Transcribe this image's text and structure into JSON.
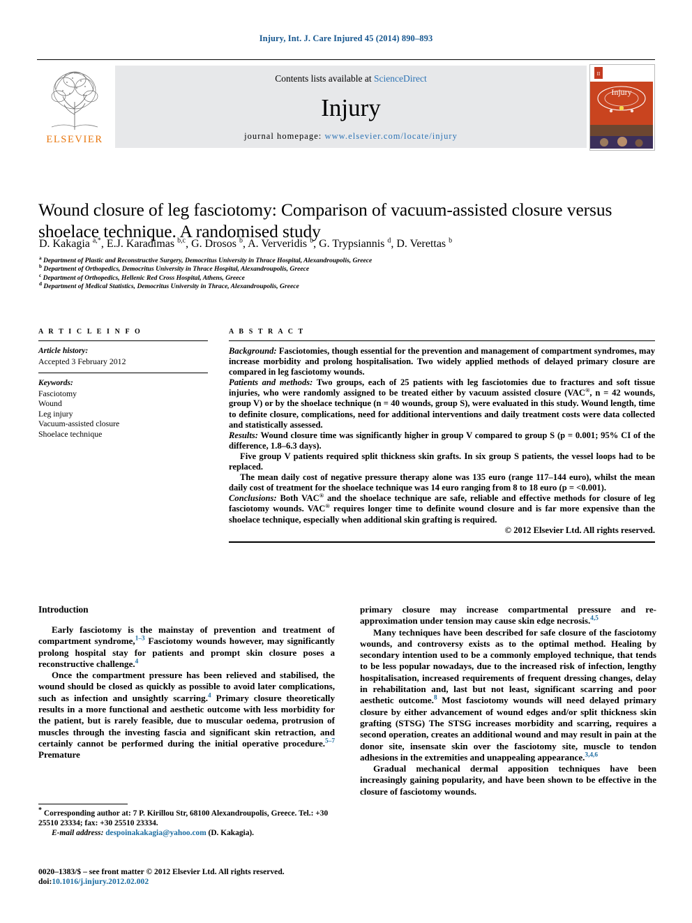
{
  "runhead": "Injury, Int. J. Care Injured 45 (2014) 890–893",
  "masthead": {
    "contents_prefix": "Contents lists available at ",
    "sciencedirect": "ScienceDirect",
    "journal_name": "Injury",
    "homepage_label": "journal homepage: ",
    "homepage_url": "www.elsevier.com/locate/injury",
    "publisher": "ELSEVIER",
    "accent_orange": "#e8760d",
    "link_blue": "#2e74b5",
    "panel_grey": "#e7e8ea"
  },
  "article": {
    "title": "Wound closure of leg fasciotomy: Comparison of vacuum-assisted closure versus shoelace technique. A randomised study",
    "authors_html": "D. Kakagia <sup>a,*</sup>, E.J. Karadimas <sup>b,c</sup>, G. Drosos <sup>b</sup>, A. Ververidis <sup>b</sup>, G. Trypsiannis <sup>d</sup>, D. Verettas <sup>b</sup>",
    "affiliations": [
      "Department of Plastic and Reconstructive Surgery, Democritus University in Thrace Hospital, Alexandroupolis, Greece",
      "Department of Orthopedics, Democritus University in Thrace Hospital, Alexandroupolis, Greece",
      "Department of Orthopedics, Hellenic Red Cross Hospital, Athens, Greece",
      "Department of Medical Statistics, Democritus University in Thrace, Alexandroupolis, Greece"
    ],
    "affiliation_marks": [
      "a",
      "b",
      "c",
      "d"
    ]
  },
  "article_info": {
    "heading": "A R T I C L E   I N F O",
    "history_label": "Article history:",
    "history_value": "Accepted 3 February 2012",
    "keywords_label": "Keywords:",
    "keywords": [
      "Fasciotomy",
      "Wound",
      "Leg injury",
      "Vacuum-assisted closure",
      "Shoelace technique"
    ]
  },
  "abstract": {
    "heading": "A B S T R A C T",
    "paragraphs": [
      {
        "label": "Background:",
        "text": " Fasciotomies, though essential for the prevention and management of compartment syndromes, may increase morbidity and prolong hospitalisation. Two widely applied methods of delayed primary closure are compared in leg fasciotomy wounds."
      },
      {
        "label": "Patients and methods:",
        "text": " Two groups, each of 25 patients with leg fasciotomies due to fractures and soft tissue injuries, who were randomly assigned to be treated either by vacuum assisted closure (VAC<sup>®</sup>, n = 42 wounds, group V) or by the shoelace technique (n = 40 wounds, group S), were evaluated in this study. Wound length, time to definite closure, complications, need for additional interventions and daily treatment costs were data collected and statistically assessed."
      },
      {
        "label": "Results:",
        "text": "  Wound closure time was significantly higher in group V compared to group S (p = 0.001; 95% CI of the difference, 1.8–6.3 days)."
      },
      {
        "label": "",
        "indent": true,
        "text": "Five group V patients required split thickness skin grafts. In six group S patients, the vessel loops had to be replaced."
      },
      {
        "label": "",
        "indent": true,
        "text": "The mean daily cost of negative pressure therapy alone was 135 euro (range 117–144 euro), whilst the mean daily cost of treatment for the shoelace technique was 14 euro ranging from 8 to 18 euro (p = <0.001)."
      },
      {
        "label": "Conclusions:",
        "text": "  Both VAC<sup>®</sup> and the shoelace technique are safe, reliable and effective methods for closure of leg fasciotomy wounds. VAC<sup>®</sup> requires longer time to definite wound closure and is far more expensive than the shoelace technique, especially when additional skin grafting is required."
      }
    ],
    "copyright": "© 2012 Elsevier Ltd. All rights reserved."
  },
  "body": {
    "intro_heading": "Introduction",
    "left_paragraphs": [
      "Early fasciotomy is the mainstay of prevention and treatment of compartment syndrome,<sup class=\"ref\">1–3</sup> Fasciotomy wounds however, may significantly prolong hospital stay for patients and prompt skin closure poses a reconstructive challenge.<sup class=\"ref\">4</sup>",
      "Once the compartment pressure has been relieved and stabilised, the wound should be closed as quickly as possible to avoid later complications, such as infection and unsightly scarring.<sup class=\"ref\">4</sup> Primary closure theoretically results in a more functional and aesthetic outcome with less morbidity for the patient, but is rarely feasible, due to muscular oedema, protrusion of muscles through the investing fascia and significant skin retraction, and certainly cannot be performed during the initial operative procedure.<sup class=\"ref\">5–7</sup> Premature"
    ],
    "right_paragraphs": [
      "primary closure may increase compartmental pressure and re-approximation under tension may cause skin edge necrosis.<sup class=\"ref\">4,5</sup>",
      "Many techniques have been described for safe closure of the fasciotomy wounds, and controversy exists as to the optimal method. Healing by secondary intention used to be a commonly employed technique, that tends to be less popular nowadays, due to the increased risk of infection, lengthy hospitalisation, increased requirements of frequent dressing changes, delay in rehabilitation and, last but not least, significant scarring and poor aesthetic outcome.<sup class=\"ref\">8</sup> Most fasciotomy wounds will need delayed primary closure by either advancement of wound edges and/or split thickness skin grafting (STSG) The STSG increases morbidity and scarring, requires a second operation, creates an additional wound and may result in pain at the donor site, insensate skin over the fasciotomy site, muscle to tendon adhesions in the extremities and unappealing appearance.<sup class=\"ref\">3,4,6</sup>",
      "Gradual mechanical dermal apposition techniques have been increasingly gaining popularity, and have been shown to be effective in the closure of fasciotomy wounds."
    ]
  },
  "footnotes": {
    "corresponding": "<span class=\"star\">*</span> Corresponding author at: 7 P. Kirillou Str, 68100 Alexandroupolis, Greece. Tel.: +30 25510 23334; fax: +30 25510 23334.",
    "email_label": "E-mail address:",
    "email": "despoinakakagia@yahoo.com",
    "email_suffix": " (D. Kakagia).",
    "issn_line": "0020–1383/$ – see front matter © 2012 Elsevier Ltd. All rights reserved.",
    "doi_label": "doi:",
    "doi": "10.1016/j.injury.2012.02.002"
  }
}
